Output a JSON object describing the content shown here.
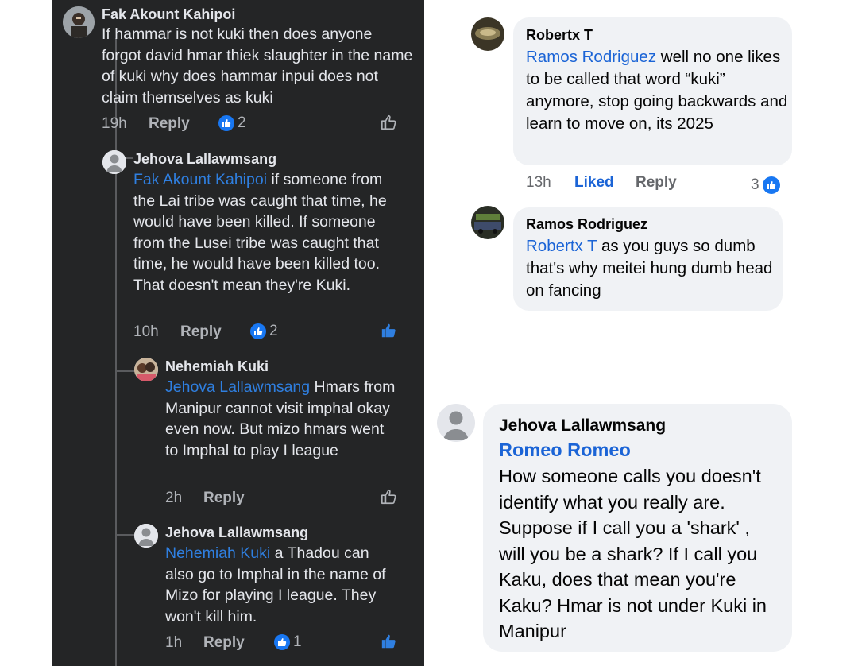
{
  "left_thread": {
    "comments": [
      {
        "author": "Fak Akount Kahipoi",
        "text": "If hammar is not kuki then does anyone forgot david hmar thiek slaughter in the name of kuki why does hammar inpui does not claim themselves as kuki",
        "time": "19h",
        "reply_label": "Reply",
        "reaction_count": "2"
      },
      {
        "author": "Jehova Lallawmsang",
        "mention": "Fak Akount Kahipoi",
        "text": " if someone from the Lai tribe was caught that time, he would have been killed. If someone from the Lusei tribe was caught that time, he would have been killed too. That doesn't mean they're Kuki.",
        "time": "10h",
        "reply_label": "Reply",
        "reaction_count": "2"
      },
      {
        "author": "Nehemiah Kuki",
        "mention": "Jehova Lallawmsang",
        "text": " Hmars from Manipur cannot visit imphal okay even now. But mizo hmars went to Imphal to play I league",
        "time": "2h",
        "reply_label": "Reply"
      },
      {
        "author": "Jehova Lallawmsang",
        "mention": "Nehemiah Kuki",
        "text": " a Thadou can also go to Imphal in the name of Mizo for playing I league. They won't kill him.",
        "time": "1h",
        "reply_label": "Reply",
        "reaction_count": "1"
      }
    ]
  },
  "right_thread": {
    "comments": [
      {
        "author": "Robertx T",
        "mention": "Ramos Rodriguez",
        "text": " well no one likes to be called that word “kuki” anymore, stop going backwards and learn to move on, its 2025",
        "time": "13h",
        "liked_label": "Liked",
        "reply_label": "Reply",
        "reaction_count": "3"
      },
      {
        "author": "Ramos Rodriguez",
        "mention": "Robertx T",
        "text": " as you guys so dumb that's why meitei hung dumb head on fancing"
      },
      {
        "author": "Jehova Lallawmsang",
        "mention": "Romeo Romeo",
        "text": "How someone calls you doesn't identify what you really are. Suppose if I call you a 'shark' , will you be a shark? If I call you Kaku, does that mean you're Kaku? Hmar is not under Kuki in Manipur"
      }
    ]
  },
  "colors": {
    "dark_bg": "#242526",
    "dark_text": "#e4e6eb",
    "dark_meta": "#b0b3b8",
    "mention_dark": "#2f7fe0",
    "mention_light": "#1b64d6",
    "bubble_light": "#f0f2f5",
    "like_blue": "#1877f2"
  }
}
